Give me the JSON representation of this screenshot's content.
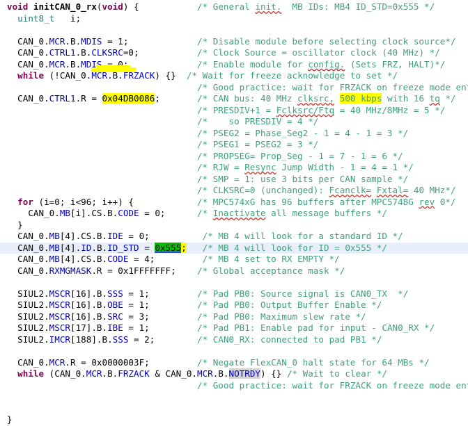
{
  "editor": {
    "background_color": "#ffffff",
    "current_line_color": "#e8eefa",
    "highlight_color": "#ffff00",
    "selection_color": "#00c000",
    "occurrence_color": "#d4d4d4",
    "keyword_color": "#7f0055",
    "field_color": "#0000c0",
    "comment_color": "#3f9f7f",
    "language": "C",
    "total_lines": 36
  },
  "lines": [
    {
      "n": 1,
      "segments": [
        {
          "t": "void ",
          "c": "kw"
        },
        {
          "t": "initCAN_0_rx",
          "c": "fn"
        },
        {
          "t": "(",
          "c": "plain"
        },
        {
          "t": "void",
          "c": "kw"
        },
        {
          "t": ") {",
          "c": "plain"
        }
      ],
      "comment": "/* General init.  MB IDs: MB4 ID_STD=0x555 */",
      "comment_col": 36,
      "squiggles": [
        "init."
      ]
    },
    {
      "n": 2,
      "segments": [
        {
          "t": "  ",
          "c": "plain"
        },
        {
          "t": "uint8_t",
          "c": "type"
        },
        {
          "t": "   i;",
          "c": "plain"
        }
      ],
      "comment": "",
      "comment_col": 0
    },
    {
      "n": 3,
      "segments": [],
      "comment": "",
      "comment_col": 0
    },
    {
      "n": 4,
      "segments": [
        {
          "t": "  CAN_0.",
          "c": "plain"
        },
        {
          "t": "MCR",
          "c": "field"
        },
        {
          "t": ".B.",
          "c": "plain"
        },
        {
          "t": "MDIS",
          "c": "field"
        },
        {
          "t": " = 1;",
          "c": "plain"
        }
      ],
      "comment": "/* Disable module before selecting clock source*/",
      "comment_col": 36
    },
    {
      "n": 5,
      "segments": [
        {
          "t": "  CAN_0.",
          "c": "plain"
        },
        {
          "t": "CTRL1",
          "c": "field"
        },
        {
          "t": ".B.",
          "c": "plain"
        },
        {
          "t": "CLKSRC",
          "c": "field"
        },
        {
          "t": "=0;",
          "c": "plain"
        }
      ],
      "comment": "/* Clock Source = oscillator clock (40 MHz) */",
      "comment_col": 36
    },
    {
      "n": 6,
      "segments": [
        {
          "t": "  CAN_0.",
          "c": "plain"
        },
        {
          "t": "MCR",
          "c": "field"
        },
        {
          "t": ".B.",
          "c": "plain"
        },
        {
          "t": "MDIS",
          "c": "field"
        },
        {
          "t": " = 0;",
          "c": "plain"
        }
      ],
      "comment": "/* Enable module for config. (Sets FRZ, HALT)*/",
      "comment_col": 36,
      "squiggles": [
        "config."
      ]
    },
    {
      "n": 7,
      "segments": [
        {
          "t": "  ",
          "c": "plain"
        },
        {
          "t": "while",
          "c": "kw"
        },
        {
          "t": " (!CAN_0.",
          "c": "plain"
        },
        {
          "t": "MCR",
          "c": "field"
        },
        {
          "t": ".B.",
          "c": "plain"
        },
        {
          "t": "FRZACK",
          "c": "field"
        },
        {
          "t": ") {}",
          "c": "plain"
        }
      ],
      "comment": "/* Wait for freeze acknowledge to set */",
      "comment_col": 34
    },
    {
      "n": 8,
      "segments": [],
      "comment": "/* Good practice: wait for FRZACK on freeze mode entry/exit */",
      "comment_col": 36
    },
    {
      "n": 9,
      "segments": [
        {
          "t": "  CAN_0.",
          "c": "plain"
        },
        {
          "t": "CTRL1",
          "c": "field"
        },
        {
          "t": ".R",
          "c": "plain"
        },
        {
          "t": " = ",
          "c": "plain"
        },
        {
          "t": "0x04DB0086",
          "c": "plain",
          "hl": "yellow"
        },
        {
          "t": ";",
          "c": "plain"
        }
      ],
      "comment": "/* CAN bus: 40 MHz clksrc, @@500 kbps@@ with 16 tq */",
      "comment_col": 36,
      "comment_hl": "500 kbps",
      "squiggles": [
        "clksrc,",
        "tq"
      ]
    },
    {
      "n": 10,
      "segments": [],
      "comment": "/* PRESDIV+1 = Fclksrc/Ftq = 40 MHz/8MHz = 5 */",
      "comment_col": 36,
      "squiggles": [
        "Fclksrc/Ftq"
      ]
    },
    {
      "n": 11,
      "segments": [],
      "comment": "/*    so PRESDIV = 4 */",
      "comment_col": 36
    },
    {
      "n": 12,
      "segments": [],
      "comment": "/* PSEG2 = Phase_Seg2 - 1 = 4 - 1 = 3 */",
      "comment_col": 36
    },
    {
      "n": 13,
      "segments": [],
      "comment": "/* PSEG1 = PSEG2 = 3 */",
      "comment_col": 36
    },
    {
      "n": 14,
      "segments": [],
      "comment": "/* PROPSEG= Prop_Seg - 1 = 7 - 1 = 6 */",
      "comment_col": 36
    },
    {
      "n": 15,
      "segments": [],
      "comment": "/* RJW = Resync Jump Width - 1 = 4 = 1 */",
      "comment_col": 36,
      "squiggles": [
        "Resync"
      ]
    },
    {
      "n": 16,
      "segments": [],
      "comment": "/* SMP = 1: use 3 bits per CAN sample */",
      "comment_col": 36
    },
    {
      "n": 17,
      "segments": [],
      "comment": "/* CLKSRC=0 (unchanged): Fcanclk= Fxtal= 40 MHz*/",
      "comment_col": 36,
      "squiggles": [
        "Fcanclk=",
        "Fxtal="
      ]
    },
    {
      "n": 18,
      "segments": [
        {
          "t": "  ",
          "c": "plain"
        },
        {
          "t": "for",
          "c": "kw"
        },
        {
          "t": " (i=0; i<96; i++) {",
          "c": "plain"
        }
      ],
      "comment": "/* MPC574xG has 96 buffers after MPC5748G rev 0*/",
      "comment_col": 36,
      "squiggles": [
        "rev"
      ]
    },
    {
      "n": 19,
      "segments": [
        {
          "t": "    CAN_0.",
          "c": "plain"
        },
        {
          "t": "MB",
          "c": "field"
        },
        {
          "t": "[i].CS.B.",
          "c": "plain"
        },
        {
          "t": "CODE",
          "c": "field"
        },
        {
          "t": " = 0;",
          "c": "plain"
        }
      ],
      "comment": "/* Inactivate all message buffers */",
      "comment_col": 36,
      "squiggles": [
        "Inactivate"
      ]
    },
    {
      "n": 20,
      "segments": [
        {
          "t": "  }",
          "c": "plain"
        }
      ],
      "comment": "",
      "comment_col": 0
    },
    {
      "n": 21,
      "segments": [
        {
          "t": "  CAN_0.",
          "c": "plain"
        },
        {
          "t": "MB",
          "c": "field"
        },
        {
          "t": "[4].CS.B.",
          "c": "plain"
        },
        {
          "t": "IDE",
          "c": "field"
        },
        {
          "t": " = 0;",
          "c": "plain"
        }
      ],
      "comment": "/* MB 4 will look for a standard ID */",
      "comment_col": 37
    },
    {
      "n": 22,
      "current": true,
      "segments": [
        {
          "t": "  CAN_0.",
          "c": "plain"
        },
        {
          "t": "MB",
          "c": "field"
        },
        {
          "t": "[4].",
          "c": "plain"
        },
        {
          "t": "ID",
          "c": "field"
        },
        {
          "t": ".B.",
          "c": "plain"
        },
        {
          "t": "ID_STD",
          "c": "field"
        },
        {
          "t": " = ",
          "c": "plain"
        },
        {
          "t": "0x555",
          "c": "plain",
          "hl": "select"
        },
        {
          "t": ";",
          "c": "plain",
          "hl": "yellow"
        }
      ],
      "comment": "/* MB 4 will look for ID = 0x555 */",
      "comment_col": 37
    },
    {
      "n": 23,
      "segments": [
        {
          "t": "  CAN_0.",
          "c": "plain"
        },
        {
          "t": "MB",
          "c": "field"
        },
        {
          "t": "[4].CS.B.",
          "c": "plain"
        },
        {
          "t": "CODE",
          "c": "field"
        },
        {
          "t": " = 4;",
          "c": "plain"
        }
      ],
      "comment": "/* MB 4 set to RX EMPTY */",
      "comment_col": 37
    },
    {
      "n": 24,
      "segments": [
        {
          "t": "  CAN_0.",
          "c": "plain"
        },
        {
          "t": "RXMGMASK",
          "c": "field"
        },
        {
          "t": ".R = 0x1FFFFFFF;",
          "c": "plain"
        }
      ],
      "comment": "/* Global acceptance mask */",
      "comment_col": 36
    },
    {
      "n": 25,
      "segments": [],
      "comment": "",
      "comment_col": 0
    },
    {
      "n": 26,
      "segments": [
        {
          "t": "  SIUL2.",
          "c": "plain"
        },
        {
          "t": "MSCR",
          "c": "field"
        },
        {
          "t": "[16].B.",
          "c": "plain"
        },
        {
          "t": "SSS",
          "c": "field"
        },
        {
          "t": " = 1;",
          "c": "plain"
        }
      ],
      "comment": "/* Pad PB0: Source signal is CAN0_TX  */",
      "comment_col": 36
    },
    {
      "n": 27,
      "segments": [
        {
          "t": "  SIUL2.",
          "c": "plain"
        },
        {
          "t": "MSCR",
          "c": "field"
        },
        {
          "t": "[16].B.",
          "c": "plain"
        },
        {
          "t": "OBE",
          "c": "field"
        },
        {
          "t": " = 1;",
          "c": "plain"
        }
      ],
      "comment": "/* Pad PB0: Output Buffer Enable */",
      "comment_col": 36
    },
    {
      "n": 28,
      "segments": [
        {
          "t": "  SIUL2.",
          "c": "plain"
        },
        {
          "t": "MSCR",
          "c": "field"
        },
        {
          "t": "[16].B.",
          "c": "plain"
        },
        {
          "t": "SRC",
          "c": "field"
        },
        {
          "t": " = 3;",
          "c": "plain"
        }
      ],
      "comment": "/* Pad PB0: Maximum slew rate */",
      "comment_col": 36
    },
    {
      "n": 29,
      "segments": [
        {
          "t": "  SIUL2.",
          "c": "plain"
        },
        {
          "t": "MSCR",
          "c": "field"
        },
        {
          "t": "[17].B.",
          "c": "plain"
        },
        {
          "t": "IBE",
          "c": "field"
        },
        {
          "t": " = 1;",
          "c": "plain"
        }
      ],
      "comment": "/* Pad PB1: Enable pad for input - CAN0_RX */",
      "comment_col": 36
    },
    {
      "n": 30,
      "segments": [
        {
          "t": "  SIUL2.",
          "c": "plain"
        },
        {
          "t": "IMCR",
          "c": "field"
        },
        {
          "t": "[188].B.",
          "c": "plain"
        },
        {
          "t": "SSS",
          "c": "field"
        },
        {
          "t": " = 2;",
          "c": "plain"
        }
      ],
      "comment": "/* CAN0_RX: connected to pad PB1 */",
      "comment_col": 36
    },
    {
      "n": 31,
      "segments": [],
      "comment": "",
      "comment_col": 0
    },
    {
      "n": 32,
      "segments": [
        {
          "t": "  CAN_0.",
          "c": "plain"
        },
        {
          "t": "MCR",
          "c": "field"
        },
        {
          "t": ".R = 0x0000003F;",
          "c": "plain"
        }
      ],
      "comment": "/* Negate FlexCAN_0 halt state for 64 MBs */",
      "comment_col": 36
    },
    {
      "n": 33,
      "segments": [
        {
          "t": "  ",
          "c": "plain"
        },
        {
          "t": "while",
          "c": "kw"
        },
        {
          "t": " (CAN_0.",
          "c": "plain"
        },
        {
          "t": "MCR",
          "c": "field"
        },
        {
          "t": ".B.",
          "c": "plain"
        },
        {
          "t": "FRZACK",
          "c": "field"
        },
        {
          "t": " & CAN_0.",
          "c": "plain"
        },
        {
          "t": "MCR",
          "c": "field"
        },
        {
          "t": ".B.",
          "c": "plain"
        },
        {
          "t": "NOTRDY",
          "c": "field",
          "hl": "occur"
        },
        {
          "t": ") {} ",
          "c": "plain"
        },
        {
          "t": "/* Wait to clear */",
          "c": "cmt"
        }
      ],
      "comment": "",
      "comment_col": 0
    },
    {
      "n": 34,
      "segments": [],
      "comment": "/* Good practice: wait for FRZACK on freeze mode entry/exit */",
      "comment_col": 36
    },
    {
      "n": 35,
      "segments": [],
      "comment": "",
      "comment_col": 0
    },
    {
      "n": 36,
      "segments": [],
      "comment": "",
      "comment_col": 0
    },
    {
      "n": 37,
      "segments": [
        {
          "t": "}",
          "c": "plain"
        }
      ],
      "comment": "",
      "comment_col": 0
    }
  ],
  "annotations": {
    "marker_blob": {
      "description": "free-hand yellow highlighter blob",
      "color": "#ffff00"
    }
  }
}
